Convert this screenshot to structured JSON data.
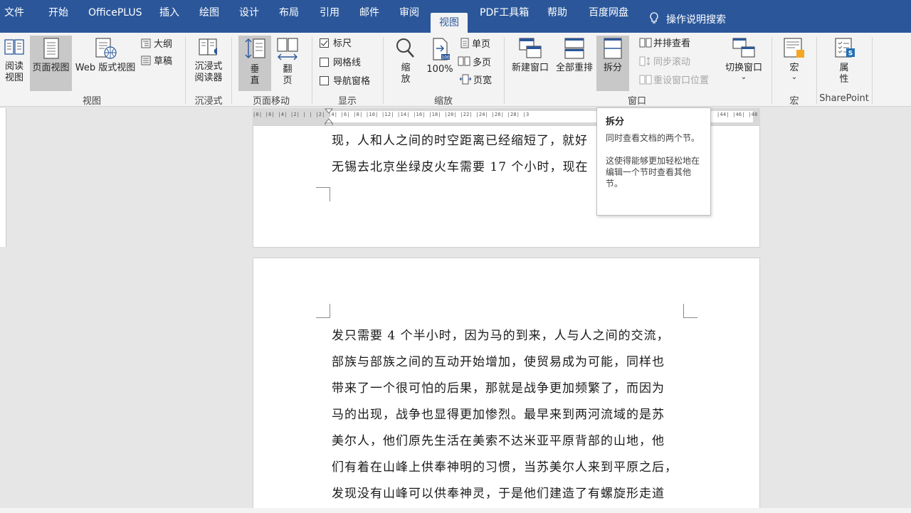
{
  "menu": {
    "tabs": [
      "文件",
      "开始",
      "OfficePLUS",
      "插入",
      "绘图",
      "设计",
      "布局",
      "引用",
      "邮件",
      "审阅",
      "视图",
      "PDF工具箱",
      "帮助",
      "百度网盘"
    ],
    "active_tab": "视图",
    "search_label": "操作说明搜索"
  },
  "ribbon": {
    "views": {
      "read_mode": "阅读\n视图",
      "print_layout": "页面视图",
      "web_layout": "Web 版式视图",
      "outline": "大纲",
      "draft": "草稿",
      "group": "视图"
    },
    "immersive": {
      "reader": "沉浸式\n阅读器",
      "group": "沉浸式"
    },
    "page_movement": {
      "vertical": "垂\n直",
      "side_to_side": "翻\n页",
      "group": "页面移动"
    },
    "show": {
      "ruler": "标尺",
      "gridlines": "网格线",
      "nav_pane": "导航窗格",
      "ruler_checked": true,
      "gridlines_checked": false,
      "nav_pane_checked": false,
      "group": "显示"
    },
    "zoom": {
      "zoom": "缩\n放",
      "hundred": "100%",
      "one_page": "单页",
      "multi_page": "多页",
      "page_width": "页宽",
      "group": "缩放"
    },
    "window": {
      "new_window": "新建窗口",
      "arrange_all": "全部重排",
      "split": "拆分",
      "side_by_side": "并排查看",
      "sync_scroll": "同步滚动",
      "reset_pos": "重设窗口位置",
      "switch_windows": "切换窗口",
      "group": "窗口"
    },
    "macros": {
      "macros": "宏",
      "group": "宏"
    },
    "sharepoint": {
      "properties": "属\n性",
      "group": "SharePoint"
    }
  },
  "ruler": {
    "ticks": "|8|  |6|  |4|  |2|  |  |  |2|  |4|  |6|  |8|  |10|  |12|  |14|  |16|  |18|  |20|  |22|  |24|  |26|  |28|  |3",
    "ticks_right": "|44|  |46|  |48"
  },
  "document": {
    "page1_lines": [
      "现，人和人之间的时空距离已经缩短了，就好",
      "无锡去北京坐绿皮火车需要 17 个小时，现在"
    ],
    "page2_lines": [
      "发只需要 4 个半小时，因为马的到来，人与人之间的交流，",
      "部族与部族之间的互动开始增加，使贸易成为可能，同样也",
      "带来了一个很可怕的后果，那就是战争更加频繁了，而因为",
      "马的出现，战争也显得更加惨烈。最早来到两河流域的是苏",
      "美尔人，他们原先生活在美索不达米亚平原背部的山地，他",
      "们有着在山峰上供奉神明的习惯，当苏美尔人来到平原之后，",
      "发现没有山峰可以供奉神灵，于是他们建造了有螺旋形走道"
    ]
  },
  "tooltip": {
    "title": "拆分",
    "line1": "同时查看文档的两个节。",
    "line2": "这使得能够更加轻松地在编辑一个节时查看其他节。"
  },
  "colors": {
    "title_bar": "#2b579a",
    "ribbon_bg": "#f3f3f3",
    "canvas_bg": "#e6e6e6",
    "selected_btn": "#c8c8c8"
  }
}
